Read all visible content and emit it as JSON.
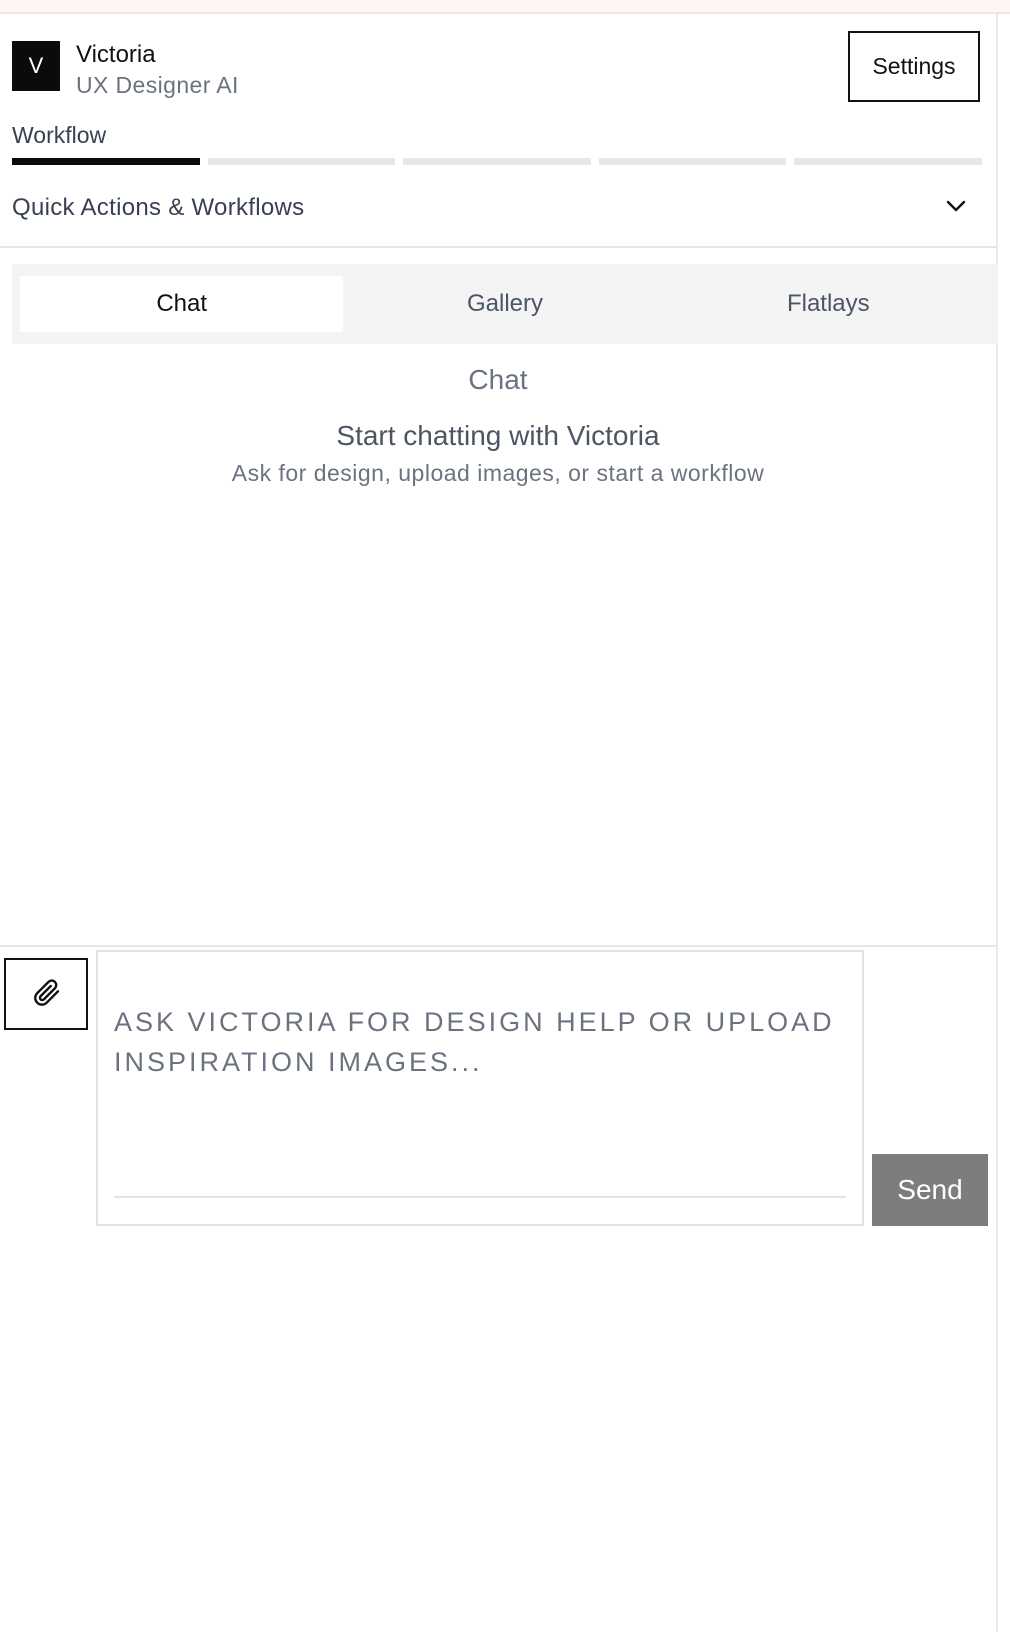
{
  "agent": {
    "avatar_letter": "V",
    "name": "Victoria",
    "role": "UX Designer AI"
  },
  "header": {
    "settings_label": "Settings"
  },
  "workflow": {
    "label": "Workflow",
    "steps_total": 5,
    "steps_completed": 1
  },
  "quick_actions": {
    "label": "Quick Actions & Workflows",
    "icon": "chevron-down-icon"
  },
  "tabs": [
    {
      "label": "Chat",
      "active": true
    },
    {
      "label": "Gallery",
      "active": false
    },
    {
      "label": "Flatlays",
      "active": false
    }
  ],
  "chat": {
    "title": "Chat",
    "empty_title": "Start chatting with Victoria",
    "empty_subtitle": "Ask for design, upload images, or start a workflow"
  },
  "composer": {
    "attach_icon": "paperclip-icon",
    "placeholder": "Ask Victoria for design help or upload inspiration images...",
    "send_label": "Send"
  },
  "colors": {
    "accent": "#0b0b0b",
    "send_button": "#7d7d7d",
    "muted_text": "#6b7280"
  }
}
